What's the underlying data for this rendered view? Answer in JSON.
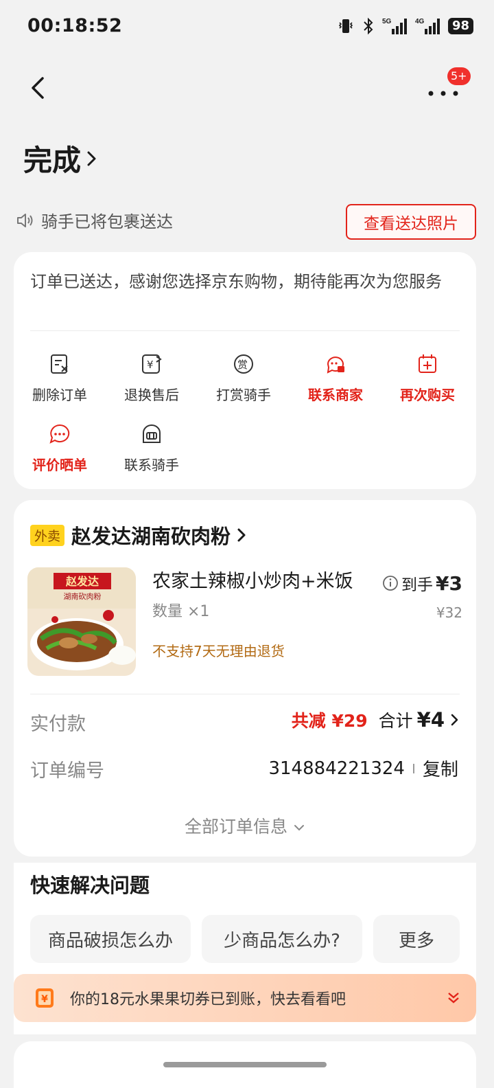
{
  "status_bar": {
    "time": "00:18:52",
    "battery": "98",
    "net1": "5G",
    "net2": "4G"
  },
  "header": {
    "more_badge": "5+"
  },
  "title": "完成",
  "notice": {
    "text": "骑手已将包裹送达",
    "photo_button": "查看送达照片"
  },
  "order_card": {
    "thanks": "订单已送达，感谢您选择京东购物，期待能再次为您服务",
    "actions": [
      {
        "label": "删除订单",
        "icon": "delete-order-icon",
        "highlight": false
      },
      {
        "label": "退换售后",
        "icon": "refund-icon",
        "highlight": false
      },
      {
        "label": "打赏骑手",
        "icon": "reward-icon",
        "highlight": false
      },
      {
        "label": "联系商家",
        "icon": "merchant-chat-icon",
        "highlight": true
      },
      {
        "label": "再次购买",
        "icon": "rebuy-icon",
        "highlight": true
      },
      {
        "label": "评价晒单",
        "icon": "review-icon",
        "highlight": true
      },
      {
        "label": "联系骑手",
        "icon": "rider-icon",
        "highlight": false
      }
    ]
  },
  "shop": {
    "tag": "外卖",
    "name": "赵发达湖南砍肉粉",
    "item": {
      "name": "农家土辣椒小炒肉+米饭",
      "quantity": "数量 ×1",
      "return_policy": "不支持7天无理由退货",
      "final_label": "到手",
      "final_price": "¥3",
      "original_price": "¥32",
      "image_text_top": "赵发达",
      "image_text_sub": "湖南砍肉粉"
    },
    "payment": {
      "label": "实付款",
      "discount": "共减 ¥29",
      "total_label": "合计",
      "total": "¥4"
    },
    "order_no": {
      "label": "订单编号",
      "value": "314884221324",
      "copy": "复制"
    },
    "all_info": "全部订单信息"
  },
  "quick": {
    "title": "快速解决问题",
    "chips": [
      "商品破损怎么办",
      "少商品怎么办?",
      "更多"
    ]
  },
  "coupon": {
    "text": "你的18元水果果切券已到账，快去看看吧"
  },
  "colors": {
    "brand_red": "#e2231a",
    "tag_yellow": "#ffd21e",
    "policy_orange": "#b26a13"
  }
}
